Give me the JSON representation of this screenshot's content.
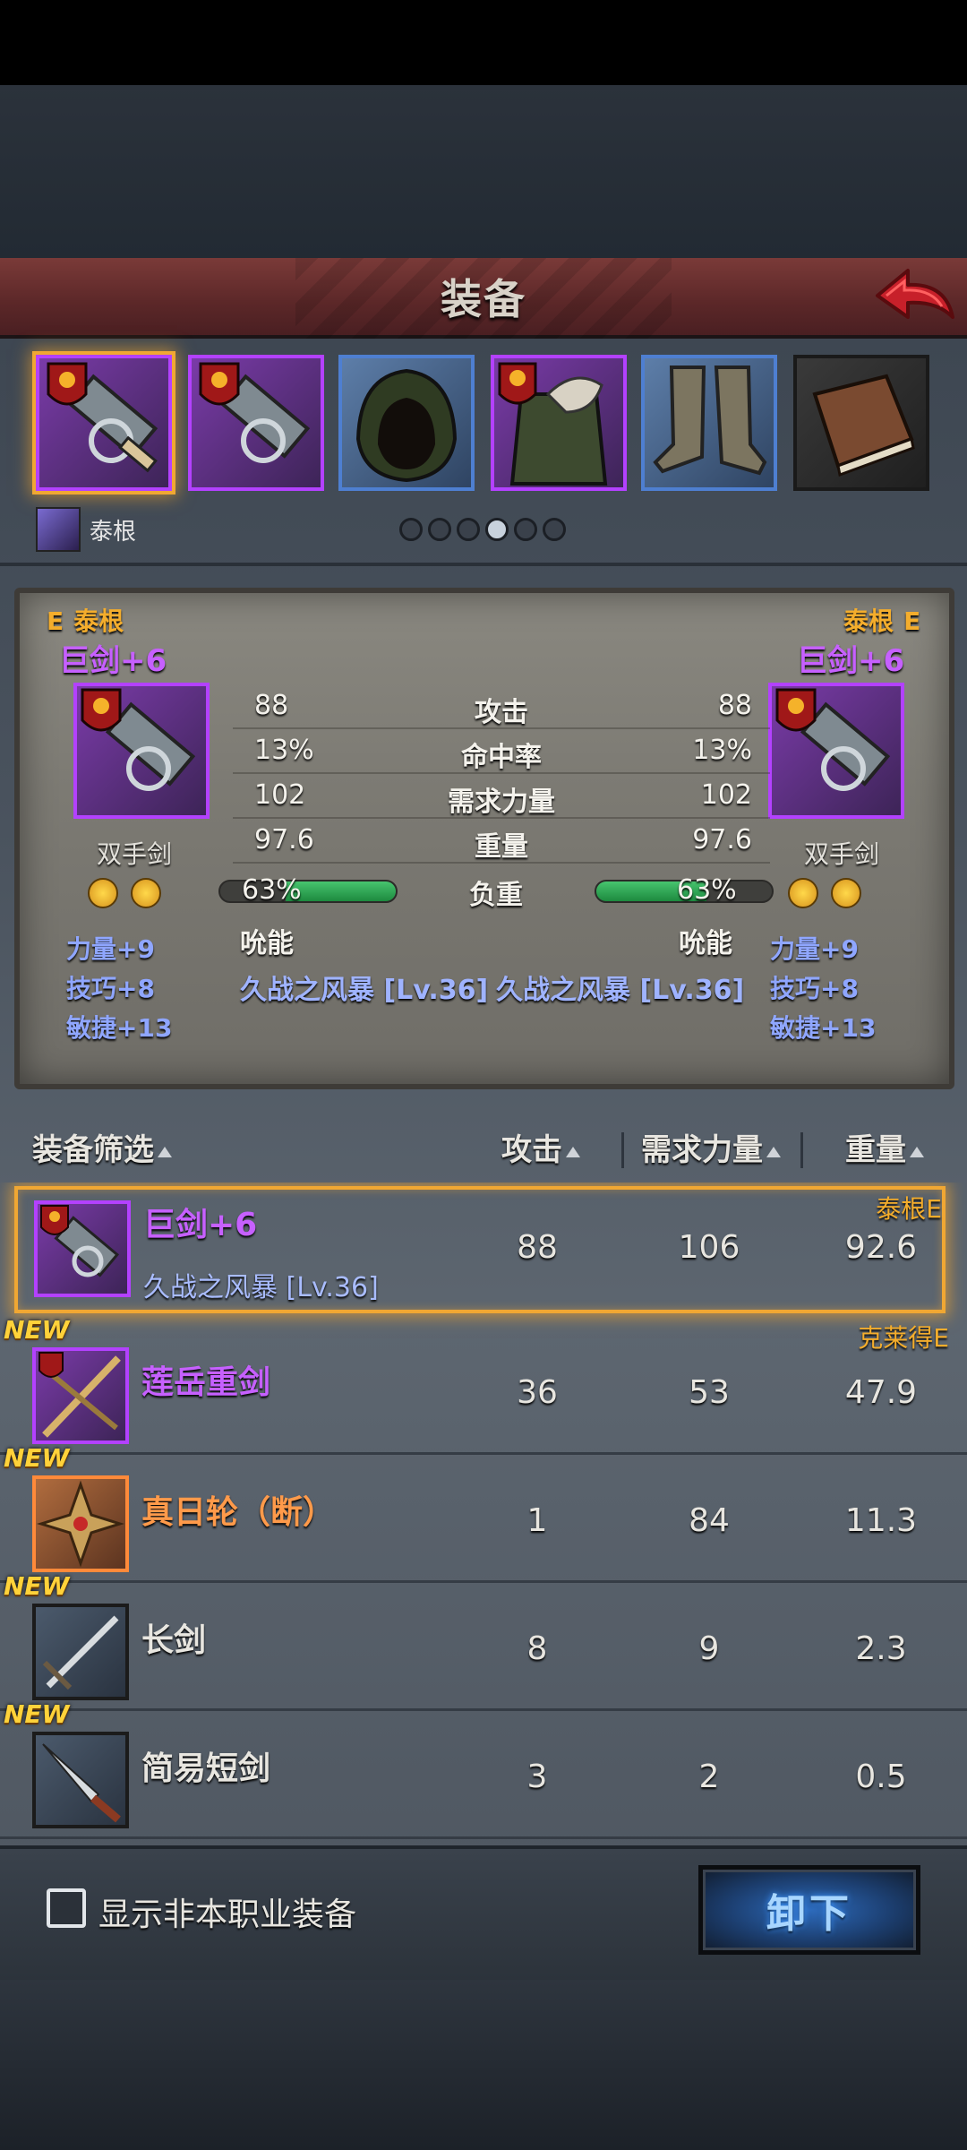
{
  "title": "装备",
  "character": {
    "name": "泰根"
  },
  "slots": [
    {
      "name": "greatsword-icon",
      "rarity": "purple",
      "selected": true
    },
    {
      "name": "greatsword-icon",
      "rarity": "purple",
      "selected": false
    },
    {
      "name": "hood-icon",
      "rarity": "blue",
      "selected": false
    },
    {
      "name": "fur-armor-icon",
      "rarity": "purple",
      "selected": false
    },
    {
      "name": "boots-icon",
      "rarity": "blue",
      "selected": false
    },
    {
      "name": "book-icon",
      "rarity": "dark",
      "selected": false
    }
  ],
  "page_dots": {
    "count": 6,
    "active_index": 3
  },
  "compare": {
    "left": {
      "grade": "E",
      "owner": "泰根",
      "weapon_name": "巨剑+6",
      "weapon_type": "双手剑",
      "bonuses": [
        "力量+9",
        "技巧+8",
        "敏捷+13"
      ]
    },
    "right": {
      "grade": "E",
      "owner": "泰根",
      "weapon_name": "巨剑+6",
      "weapon_type": "双手剑",
      "bonuses": [
        "力量+9",
        "技巧+8",
        "敏捷+13"
      ]
    },
    "stats": [
      {
        "label": "攻击",
        "left": "88",
        "right": "88"
      },
      {
        "label": "命中率",
        "left": "13%",
        "right": "13%"
      },
      {
        "label": "需求力量",
        "left": "102",
        "right": "102"
      },
      {
        "label": "重量",
        "left": "97.6",
        "right": "97.6"
      }
    ],
    "load": {
      "label": "负重",
      "left_pct": "63%",
      "right_pct": "63%",
      "fraction": 0.63
    },
    "skill": {
      "left": "吮能",
      "right": "吮能"
    },
    "effect": {
      "left": "久战之风暴 [Lv.36]",
      "right": "久战之风暴 [Lv.36]"
    }
  },
  "list_header": {
    "filter": "装备筛选",
    "attack": "攻击",
    "strength_req": "需求力量",
    "weight": "重量"
  },
  "items": [
    {
      "name": "巨剑+6",
      "name_color": "#c660ff",
      "effect": "久战之风暴 [Lv.36]",
      "attack": "88",
      "strength_req": "106",
      "weight": "92.6",
      "owner": "泰根E",
      "is_new": false,
      "new_label": "",
      "rarity": "purple",
      "icon": "greatsword-icon",
      "selected": true
    },
    {
      "name": "莲岳重剑",
      "name_color": "#c660ff",
      "effect": "",
      "attack": "36",
      "strength_req": "53",
      "weight": "47.9",
      "owner": "克莱得E",
      "is_new": true,
      "new_label": "NEW",
      "rarity": "purple",
      "icon": "ornate-sword-icon",
      "selected": false
    },
    {
      "name": "真日轮（断）",
      "name_color": "#ff9a4a",
      "effect": "",
      "attack": "1",
      "strength_req": "84",
      "weight": "11.3",
      "owner": "",
      "is_new": true,
      "new_label": "NEW",
      "rarity": "orange",
      "icon": "sun-wheel-icon",
      "selected": false
    },
    {
      "name": "长剑",
      "name_color": "#e8e6e0",
      "effect": "",
      "attack": "8",
      "strength_req": "9",
      "weight": "2.3",
      "owner": "",
      "is_new": true,
      "new_label": "NEW",
      "rarity": "plain",
      "icon": "longsword-icon",
      "selected": false
    },
    {
      "name": "简易短剑",
      "name_color": "#e8e6e0",
      "effect": "",
      "attack": "3",
      "strength_req": "2",
      "weight": "0.5",
      "owner": "",
      "is_new": true,
      "new_label": "NEW",
      "rarity": "plain",
      "icon": "short-sword-icon",
      "selected": false
    }
  ],
  "bottom": {
    "show_non_class_label": "显示非本职业装备",
    "show_non_class_checked": false,
    "unequip_label": "卸下"
  },
  "colors": {
    "accent_gold": "#f0a733",
    "purple_rarity": "#b341ff",
    "blue_rarity": "#4e7fd1",
    "orange_rarity": "#ff8a3a",
    "load_bar": "#2fae5a"
  }
}
